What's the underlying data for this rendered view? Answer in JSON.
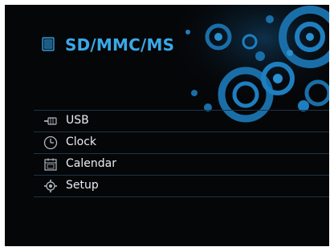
{
  "header": {
    "title": "SD/MMC/MS",
    "icon": "sd-card-icon",
    "title_color": "#3aa8e8"
  },
  "menu": {
    "items": [
      {
        "label": "USB",
        "icon": "usb-icon"
      },
      {
        "label": "Clock",
        "icon": "clock-icon"
      },
      {
        "label": "Calendar",
        "icon": "calendar-icon"
      },
      {
        "label": "Setup",
        "icon": "gear-icon"
      }
    ]
  },
  "colors": {
    "background": "#050608",
    "accent": "#3aa8e8",
    "decoration": "#1a6ea8",
    "text": "#e8eef4"
  }
}
